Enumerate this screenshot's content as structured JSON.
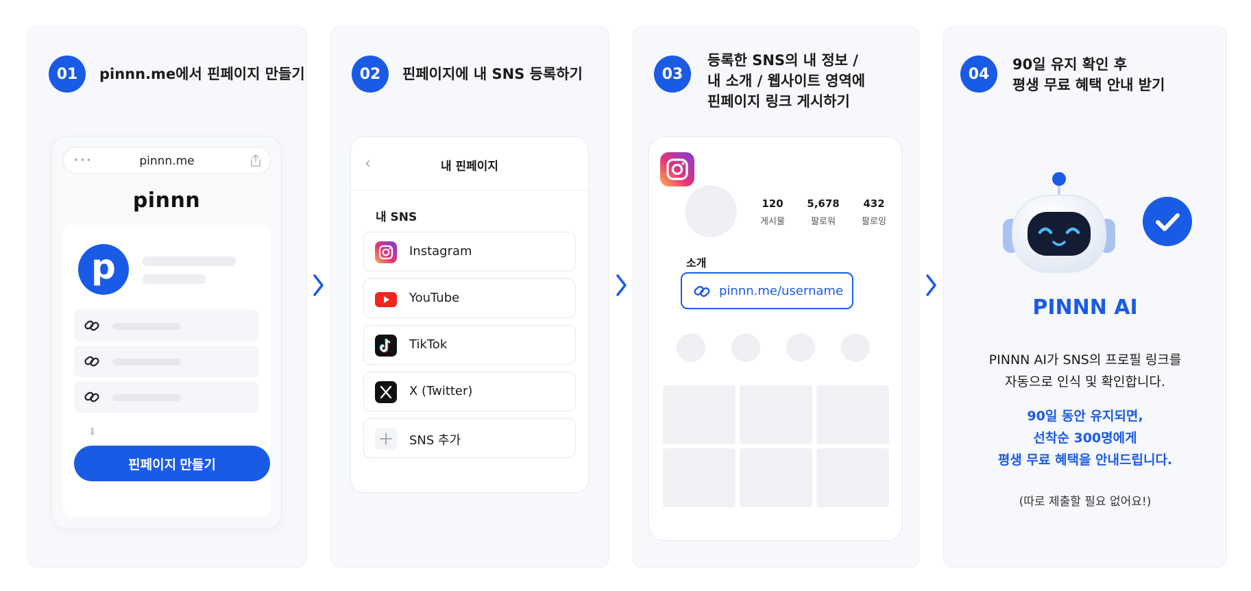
{
  "steps": [
    {
      "num": "01",
      "title": "pinnn.me에서 핀페이지 만들기"
    },
    {
      "num": "02",
      "title": "핀페이지에 내 SNS 등록하기"
    },
    {
      "num": "03",
      "title": "등록한 SNS의 내 정보 /\n내 소개 / 웹사이트 영역에\n핀페이지 링크 게시하기"
    },
    {
      "num": "04",
      "title": "90일 유지 확인 후\n평생 무료 혜택 안내 받기"
    }
  ],
  "step1": {
    "browser_dots": "•••",
    "url": "pinnn.me",
    "logo": "pinnn",
    "avatar_letter": "p",
    "button": "핀페이지 만들기",
    "icons": [
      "share-icon",
      "link-icon",
      "arrow-down-icon"
    ]
  },
  "step2": {
    "back": "‹",
    "header": "내 핀페이지",
    "section": "내 SNS",
    "sns": [
      {
        "label": "Instagram",
        "icon": "instagram-icon"
      },
      {
        "label": "YouTube",
        "icon": "youtube-icon"
      },
      {
        "label": "TikTok",
        "icon": "tiktok-icon"
      },
      {
        "label": "X (Twitter)",
        "icon": "x-icon"
      },
      {
        "label": "SNS 추가",
        "icon": "plus-icon"
      }
    ]
  },
  "step3": {
    "stats": [
      {
        "value": "120",
        "label": "게시물"
      },
      {
        "value": "5,678",
        "label": "팔로워"
      },
      {
        "value": "432",
        "label": "팔로잉"
      }
    ],
    "bio_label": "소개",
    "bio_link": "pinnn.me/username"
  },
  "step4": {
    "brand": "PINNN AI",
    "desc": [
      "PINNN AI가 SNS의 프로필 링크를",
      "자동으로 인식 및 확인합니다."
    ],
    "highlight": [
      "90일 동안 유지되면,",
      "선착순 300명에게",
      "평생 무료 혜택을 안내드립니다."
    ],
    "note": "(따로 제출할 필요 없어요!)"
  },
  "colors": {
    "accent": "#1a5be6",
    "panel_bg": "#f7f8fb"
  }
}
